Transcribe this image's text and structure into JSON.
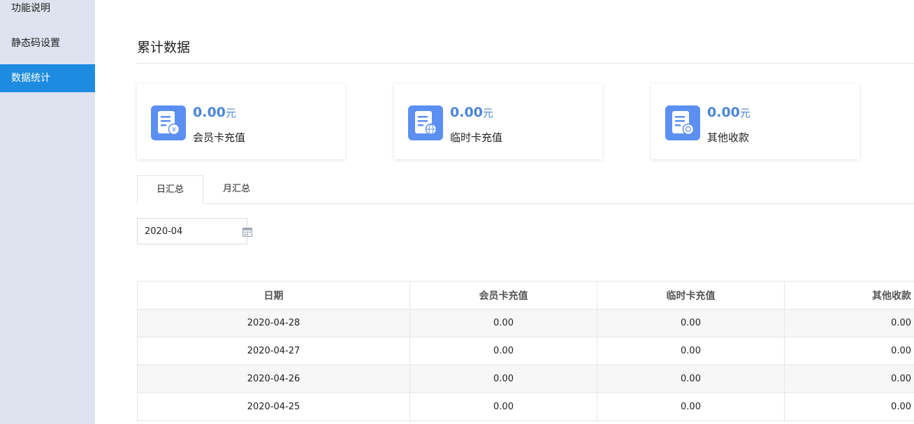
{
  "sidebar": {
    "items": [
      {
        "label": "功能说明",
        "active": false
      },
      {
        "label": "静态码设置",
        "active": false
      },
      {
        "label": "数据统计",
        "active": true
      }
    ]
  },
  "main": {
    "title": "累计数据",
    "cards": [
      {
        "value": "0.00",
        "unit": "元",
        "label": "会员卡充值",
        "icon": "receipt-yen-icon"
      },
      {
        "value": "0.00",
        "unit": "元",
        "label": "临时卡充值",
        "icon": "receipt-globe-icon"
      },
      {
        "value": "0.00",
        "unit": "元",
        "label": "其他收款",
        "icon": "receipt-coin-icon"
      }
    ],
    "tabs": [
      {
        "label": "日汇总",
        "active": true
      },
      {
        "label": "月汇总",
        "active": false
      }
    ],
    "date_picker": {
      "value": "2020-04",
      "icon": "calendar-icon"
    },
    "table": {
      "headers": [
        "日期",
        "会员卡充值",
        "临时卡充值",
        "其他收款"
      ],
      "rows": [
        [
          "2020-04-28",
          "0.00",
          "0.00",
          "0.00"
        ],
        [
          "2020-04-27",
          "0.00",
          "0.00",
          "0.00"
        ],
        [
          "2020-04-26",
          "0.00",
          "0.00",
          "0.00"
        ],
        [
          "2020-04-25",
          "0.00",
          "0.00",
          "0.00"
        ]
      ]
    },
    "colors": {
      "accent": "#1d8ce0",
      "value_blue": "#4a86d8",
      "sidebar_bg": "#dde4ef",
      "icon_blue": "#5b8ff2"
    }
  }
}
